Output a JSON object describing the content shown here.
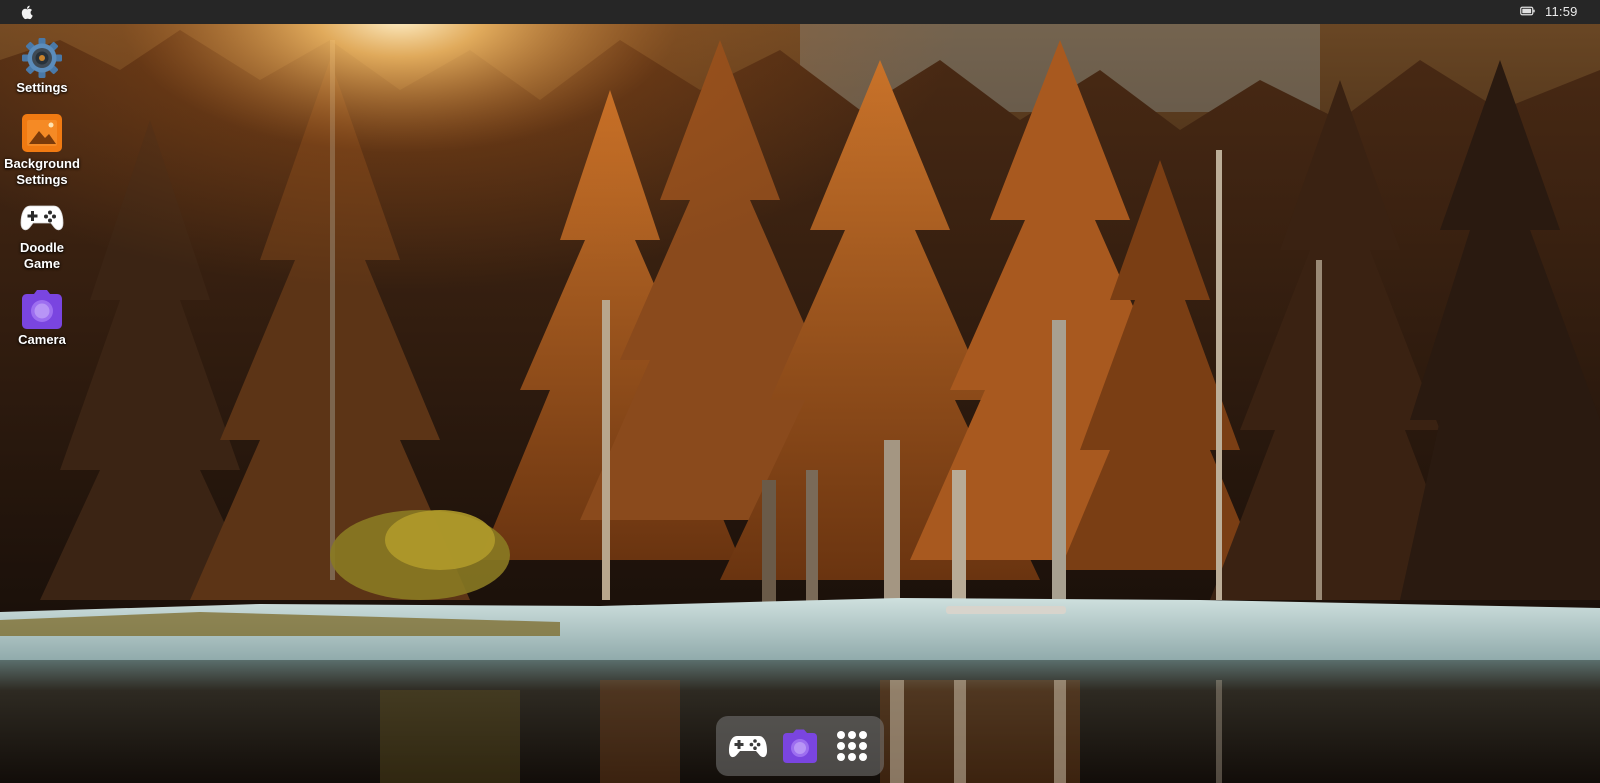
{
  "topbar": {
    "apple_icon": "apple-logo",
    "battery_icon": "battery-icon",
    "clock": "11:59"
  },
  "desktop_icons": [
    {
      "label": "Settings",
      "icon": "gear-icon",
      "color": "#4a79a8"
    },
    {
      "label": "Background\nSettings",
      "icon": "image-icon",
      "color": "#f07a12"
    },
    {
      "label": "Doodle\nGame",
      "icon": "gamepad-icon",
      "color": "#ffffff"
    },
    {
      "label": "Camera",
      "icon": "camera-icon",
      "color": "#7a45e0"
    }
  ],
  "dock": {
    "items": [
      {
        "icon": "gamepad-icon"
      },
      {
        "icon": "camera-icon"
      },
      {
        "icon": "app-grid-icon"
      }
    ]
  }
}
